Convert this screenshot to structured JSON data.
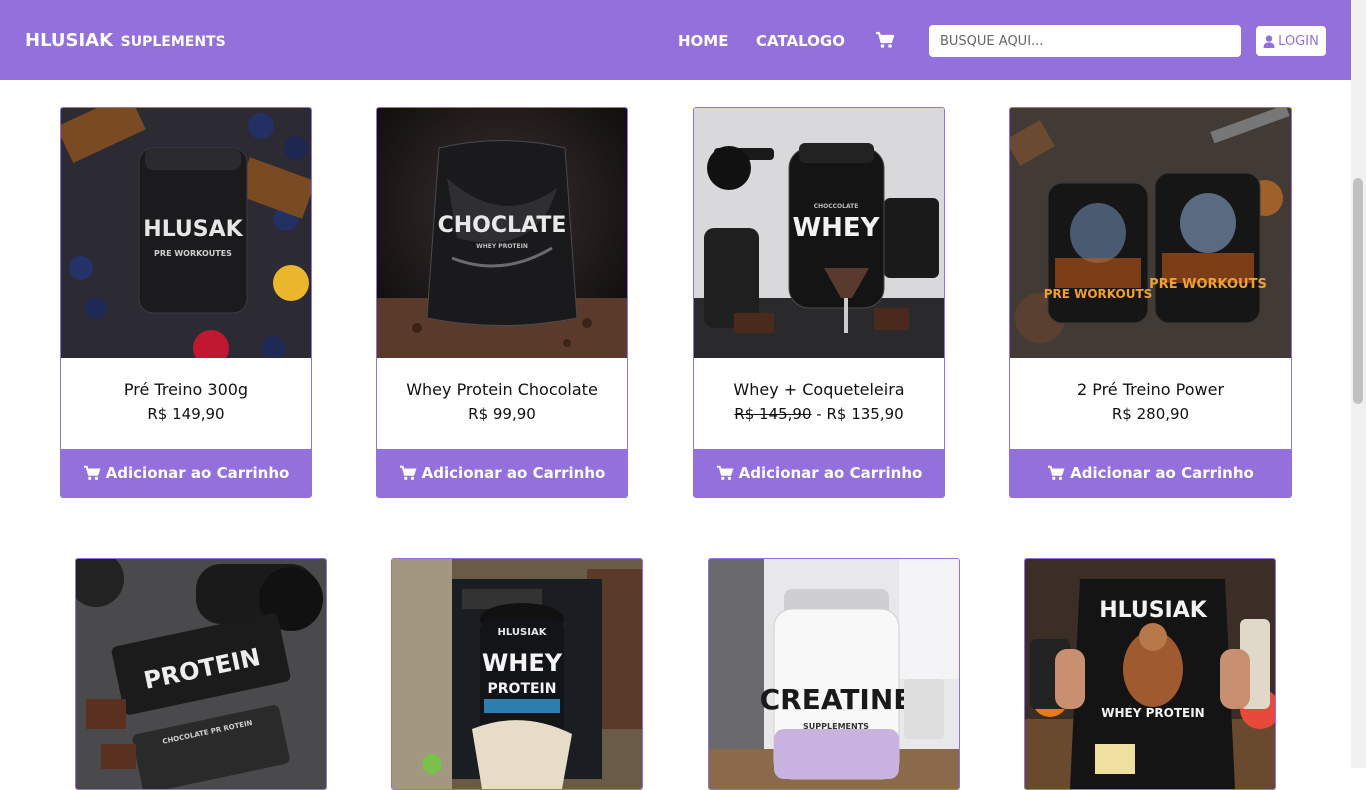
{
  "header": {
    "brand_main": "HLUSIAK",
    "brand_sub": "SUPLEMENTS",
    "nav": {
      "home": "HOME",
      "catalog": "CATALOGO"
    },
    "search_placeholder": "BUSQUE AQUI...",
    "login_label": "LOGIN"
  },
  "add_to_cart_label": "Adicionar ao Carrinho",
  "products": [
    {
      "name": "Pré Treino 300g",
      "price": "R$ 149,90",
      "image_text": [
        "HLUSAK",
        "PRE WORKOUTES"
      ]
    },
    {
      "name": "Whey Protein Chocolate",
      "price": "R$ 99,90",
      "image_text": [
        "CHOCLATE",
        "WHEY PROTEIN"
      ]
    },
    {
      "name": "Whey + Coqueteleira",
      "old_price": "R$ 145,90",
      "separator": "-",
      "price": "R$ 135,90",
      "image_text": [
        "CHOCCOLATE",
        "WHEY"
      ]
    },
    {
      "name": "2 Pré Treino Power",
      "price": "R$ 280,90",
      "image_text": [
        "PRE WORKOUTS",
        "PRE WORKOUTS"
      ]
    },
    {
      "image_text": [
        "PROTEIN",
        "CHOCOLATE PR ROTEIN"
      ]
    },
    {
      "image_text": [
        "HLUSIAK",
        "WHEY",
        "PROTEIN"
      ]
    },
    {
      "image_text": [
        "CREATINE",
        "SUPPLEMENTS"
      ]
    },
    {
      "image_text": [
        "HLUSIAK",
        "WHEY PROTEIN"
      ]
    }
  ],
  "colors": {
    "accent": "#9370db",
    "text": "#111111",
    "background": "#ffffff"
  }
}
